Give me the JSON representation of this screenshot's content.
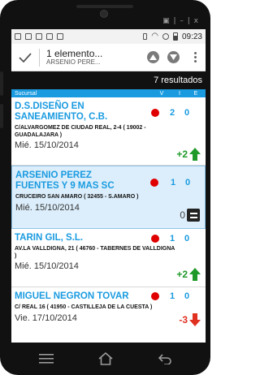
{
  "window": {
    "controls": "▣ | – | x"
  },
  "statusbar": {
    "time": "09:23"
  },
  "actionbar": {
    "title": "1 elemento...",
    "subtitle": "ARSENIO PERE..."
  },
  "results": "7 resultados",
  "columns": {
    "sucursal": "Sucursal",
    "v": "V",
    "i": "I",
    "e": "E"
  },
  "items": [
    {
      "name": "D.S.DISEÑO EN SANEAMIENTO, C.B.",
      "address": "C/ALVARGOMEZ DE CIUDAD REAL, 2-4 ( 19002 - GUADALAJARA )",
      "date": "Mié. 15/10/2014",
      "i": "2",
      "e": "0",
      "trend_value": "+2",
      "trend": "up"
    },
    {
      "name": "ARSENIO PEREZ FUENTES Y 9 MAS SC",
      "address": "CRUCEIRO SAN AMARO ( 32455 - S.AMARO )",
      "date": "Mié. 15/10/2014",
      "i": "1",
      "e": "0",
      "trend_value": "0",
      "trend": "equal"
    },
    {
      "name": "TARIN GIL, S.L.",
      "address": "AV.LA VALLDIGNA, 21 ( 46760 - TABERNES DE VALLDIGNA )",
      "date": "Mié. 15/10/2014",
      "i": "1",
      "e": "0",
      "trend_value": "+2",
      "trend": "up"
    },
    {
      "name": "MIGUEL NEGRON TOVAR",
      "address": "C/ REAL 16 ( 41950 - CASTILLEJA DE LA CUESTA )",
      "date": "Vie. 17/10/2014",
      "i": "1",
      "e": "0",
      "trend_value": "-3",
      "trend": "down"
    }
  ],
  "colors": {
    "accent": "#1a9be0",
    "red_dot": "#e00000",
    "up": "#1f9a2a",
    "down": "#e03020",
    "selected_bg": "#dceefb"
  },
  "icons": {
    "check": "check-icon",
    "up_circle": "up-circle-icon",
    "down_circle": "down-circle-icon",
    "overflow": "overflow-menu-icon",
    "nav_menu": "menu-icon",
    "nav_home": "home-icon",
    "nav_back": "back-icon"
  }
}
